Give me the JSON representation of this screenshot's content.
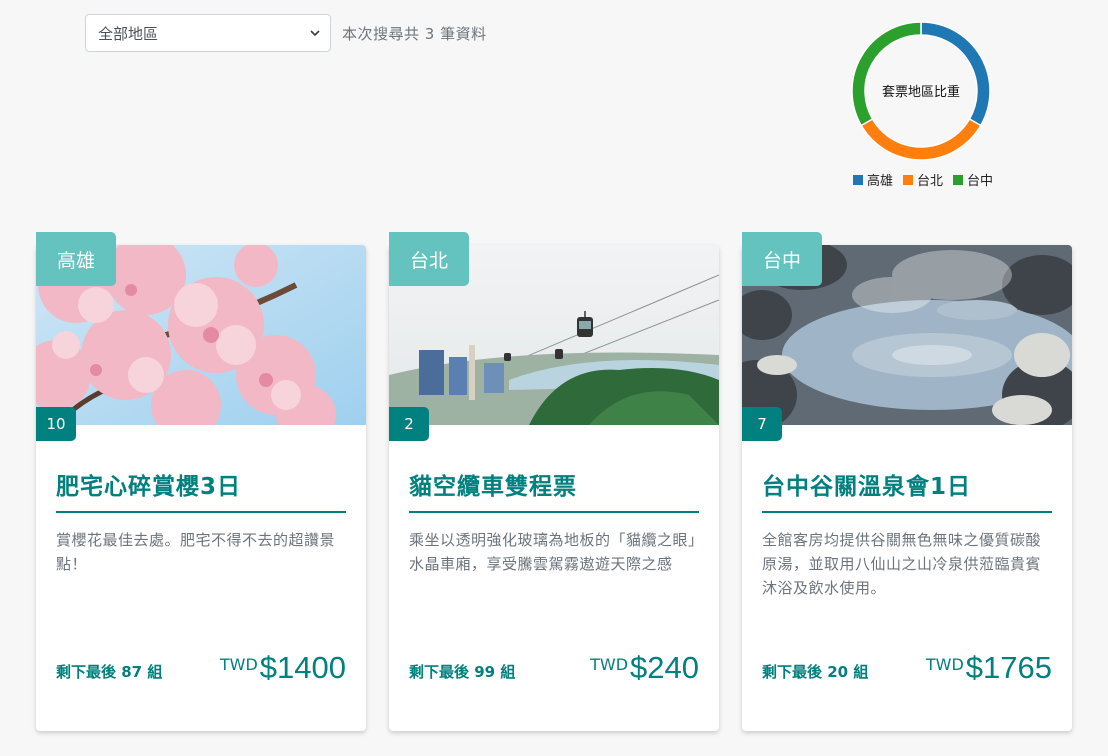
{
  "filter": {
    "region_select_value": "全部地區",
    "result_text": "本次搜尋共 3 筆資料"
  },
  "chart_data": {
    "type": "pie",
    "title": "套票地區比重",
    "categories": [
      "高雄",
      "台北",
      "台中"
    ],
    "values": [
      1,
      1,
      1
    ],
    "colors": [
      "#1f77b4",
      "#ff7f0e",
      "#2ca02c"
    ],
    "legend_position": "bottom"
  },
  "cards": [
    {
      "region": "高雄",
      "rank": "10",
      "title": "肥宅心碎賞櫻3日",
      "description": "賞櫻花最佳去處。肥宅不得不去的超讚景點！",
      "stock": "剩下最後 87 組",
      "currency": "TWD",
      "price": "$1400",
      "image": "cherry-blossom-photo"
    },
    {
      "region": "台北",
      "rank": "2",
      "title": "貓空纜車雙程票",
      "description": "乘坐以透明強化玻璃為地板的「貓纜之眼」水晶車廂，享受騰雲駕霧遨遊天際之感",
      "stock": "剩下最後 99 組",
      "currency": "TWD",
      "price": "$240",
      "image": "gondola-cable-car-photo"
    },
    {
      "region": "台中",
      "rank": "7",
      "title": "台中谷關溫泉會1日",
      "description": "全館客房均提供谷關無色無味之優質碳酸原湯，並取用八仙山之山冷泉供蒞臨貴賓沐浴及飲水使用。",
      "stock": "剩下最後 20 組",
      "currency": "TWD",
      "price": "$1765",
      "image": "hot-spring-photo"
    }
  ]
}
